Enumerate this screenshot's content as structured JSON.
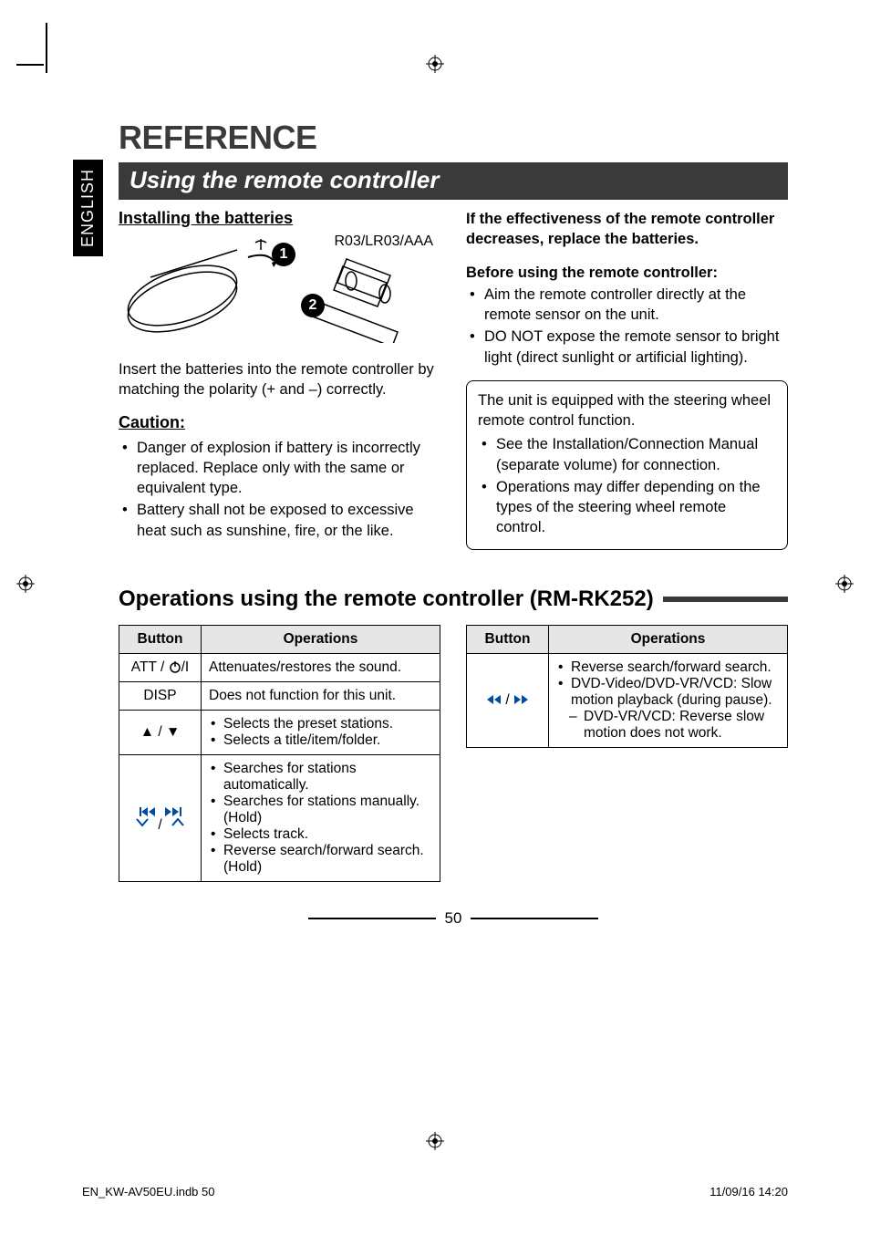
{
  "lang_tab": "ENGLISH",
  "title": "REFERENCE",
  "section_bar": "Using the remote controller",
  "left": {
    "installing_head": "Installing the batteries",
    "battery_label": "R03/LR03/AAA",
    "badge1": "1",
    "badge2": "2",
    "insert_text": "Insert the batteries into the remote controller by matching the polarity (+ and –) correctly.",
    "caution_head": "Caution:",
    "caution_items": [
      "Danger of explosion if battery is incorrectly replaced. Replace only with the same or equivalent type.",
      "Battery shall not be exposed to excessive heat such as sunshine, fire, or the like."
    ]
  },
  "right": {
    "effectiveness": "If the effectiveness of the remote controller decreases, replace the batteries.",
    "before_head": "Before using the remote controller:",
    "before_items": [
      "Aim the remote controller directly at the remote sensor on the unit.",
      "DO NOT expose the remote sensor to bright light (direct sunlight or artificial lighting)."
    ],
    "box_lead": "The unit is equipped with the steering wheel remote control function.",
    "box_items": [
      "See the Installation/Connection Manual (separate volume) for connection.",
      "Operations may differ depending on the types of the steering wheel remote control."
    ]
  },
  "ops_head": "Operations using the remote controller (RM-RK252)",
  "table_headers": {
    "button": "Button",
    "operations": "Operations"
  },
  "table_left": [
    {
      "button_text": "ATT / ",
      "button_suffix": "",
      "ops_plain": "Attenuates/restores the sound."
    },
    {
      "button_text": "DISP",
      "ops_plain": "Does not function for this unit."
    },
    {
      "button_icons": "updown",
      "ops_list": [
        "Selects the preset stations.",
        "Selects a title/item/folder."
      ]
    },
    {
      "button_icons": "skip",
      "ops_list": [
        "Searches for stations automatically.",
        "Searches for stations manually. (Hold)",
        "Selects track.",
        "Reverse search/forward search. (Hold)"
      ]
    }
  ],
  "table_right": [
    {
      "button_icons": "rwff",
      "ops_list": [
        "Reverse search/forward search.",
        "DVD-Video/DVD-VR/VCD: Slow motion playback (during pause)."
      ],
      "ops_sublist": [
        "DVD-VR/VCD: Reverse slow motion does not work."
      ]
    }
  ],
  "page_number": "50",
  "footer_left": "EN_KW-AV50EU.indb   50",
  "footer_right": "11/09/16   14:20"
}
